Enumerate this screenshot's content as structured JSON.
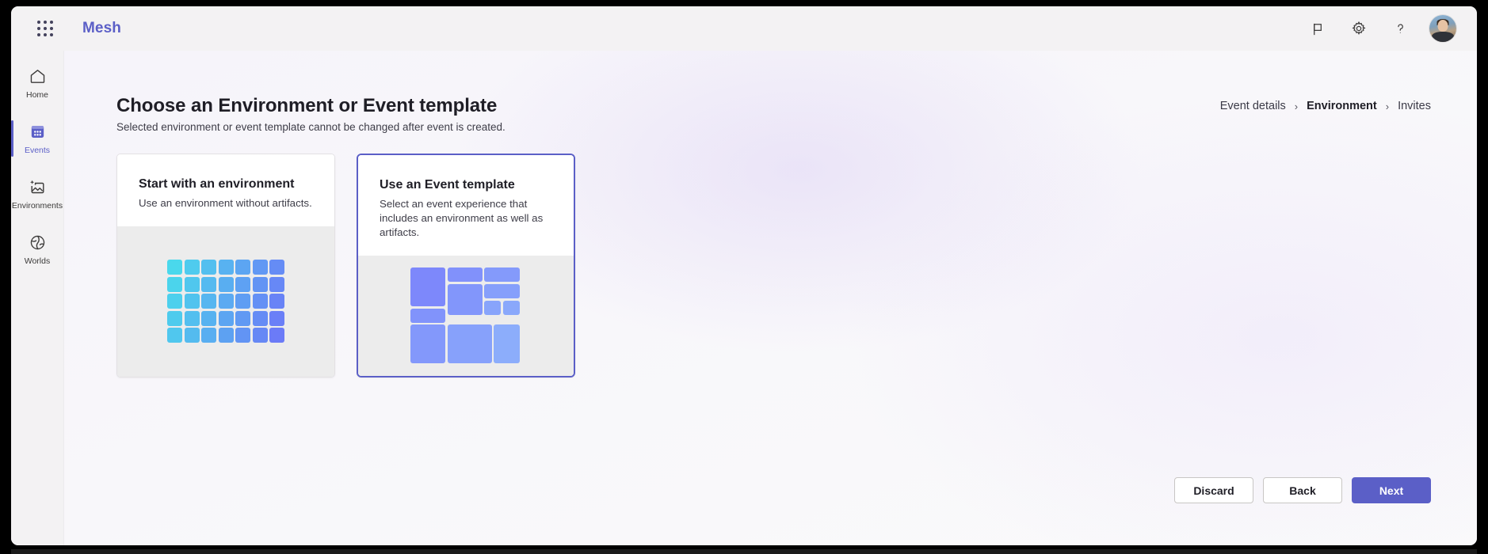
{
  "topbar": {
    "app_launcher": "app-launcher",
    "brand": "Mesh",
    "actions": [
      {
        "name": "flag-icon",
        "label": "Feedback"
      },
      {
        "name": "gear-icon",
        "label": "Settings"
      },
      {
        "name": "help-icon",
        "label": "?"
      }
    ],
    "avatar_alt": "User profile photo"
  },
  "sidebar": {
    "items": [
      {
        "label": "Home",
        "icon": "home-icon",
        "active": false
      },
      {
        "label": "Events",
        "icon": "calendar-icon",
        "active": true
      },
      {
        "label": "Environments",
        "icon": "image-sparkle-icon",
        "active": false
      },
      {
        "label": "Worlds",
        "icon": "globe-icon",
        "active": false
      }
    ]
  },
  "page": {
    "title": "Choose an Environment or Event template",
    "subtitle": "Selected environment or event template cannot be changed after event is created."
  },
  "breadcrumb": {
    "items": [
      {
        "label": "Event details",
        "current": false
      },
      {
        "label": "Environment",
        "current": true
      },
      {
        "label": "Invites",
        "current": false
      }
    ],
    "separator": "›"
  },
  "cards": [
    {
      "title": "Start with an environment",
      "description": "Use an environment without artifacts.",
      "selected": false,
      "art": "grid"
    },
    {
      "title": "Use an Event template",
      "description": "Select an event experience that includes an environment as well as artifacts.",
      "selected": true,
      "art": "mosaic"
    }
  ],
  "footer": {
    "discard_label": "Discard",
    "back_label": "Back",
    "next_label": "Next"
  },
  "colors": {
    "accent": "#5b5fc7",
    "topbar_bg": "#f3f2f3",
    "card_art_bg": "#ececec",
    "grid_from": "#4ad8ec",
    "grid_to": "#6b7bf7",
    "mosaic_from": "#7b83fb",
    "mosaic_to": "#8fb6fb"
  }
}
